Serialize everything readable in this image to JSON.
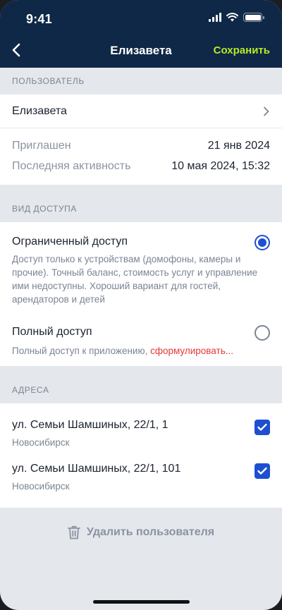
{
  "status_bar": {
    "time": "9:41"
  },
  "nav": {
    "title": "Елизавета",
    "save_label": "Сохранить"
  },
  "user_section": {
    "title": "ПОЛЬЗОВАТЕЛЬ",
    "name": "Елизавета",
    "rows": [
      {
        "label": "Приглашен",
        "value": "21 янв 2024"
      },
      {
        "label": "Последняя активность",
        "value": "10 мая 2024, 15:32"
      }
    ]
  },
  "access_section": {
    "title": "ВИД ДОСТУПА",
    "options": [
      {
        "name": "Ограниченный доступ",
        "description": "Доступ только к устройствам (домофоны, камеры и прочие). Точный баланс, стоимость услуг и управление ими недоступны. Хороший вариант для гостей, арендаторов и детей",
        "selected": true
      },
      {
        "name": "Полный доступ",
        "description": "Полный доступ к приложению, ",
        "description_highlight": "сформулировать...",
        "selected": false
      }
    ]
  },
  "addresses_section": {
    "title": "АДРЕСА",
    "items": [
      {
        "street": "ул. Семьи Шамшиных, 22/1, 1",
        "city": "Новосибирск",
        "checked": true
      },
      {
        "street": "ул. Семьи Шамшиных, 22/1, 101",
        "city": "Новосибирск",
        "checked": true
      }
    ]
  },
  "delete_label": "Удалить пользователя",
  "colors": {
    "header_bg": "#0f2847",
    "accent": "#b9ea27",
    "selection": "#1d4fd3",
    "highlight": "#e53935"
  }
}
